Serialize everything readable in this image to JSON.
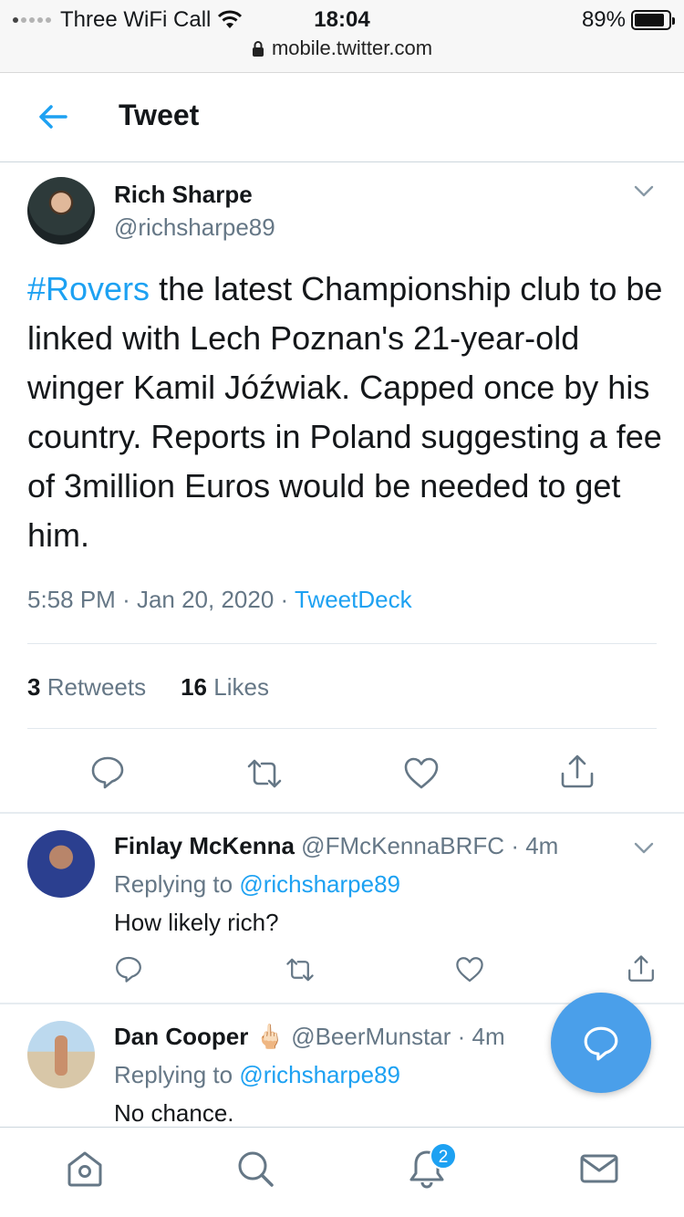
{
  "status_bar": {
    "carrier": "Three WiFi Call",
    "time": "18:04",
    "battery": "89%",
    "battery_level": 0.89,
    "url": "mobile.twitter.com"
  },
  "header": {
    "title": "Tweet",
    "back_icon": "arrow-left-icon"
  },
  "tweet": {
    "author_name": "Rich Sharpe",
    "author_handle": "@richsharpe89",
    "hashtag": "#Rovers",
    "text": " the latest Championship club to be linked with Lech Poznan's 21-year-old winger Kamil Jóźwiak. Capped once by his country. Reports in Poland suggesting a fee of 3million Euros would be needed to get him.",
    "time": "5:58 PM",
    "date": "Jan 20, 2020",
    "source": "TweetDeck",
    "retweets_count": "3",
    "retweets_label": "Retweets",
    "likes_count": "16",
    "likes_label": "Likes"
  },
  "replies": [
    {
      "name": "Finlay McKenna",
      "handle": "@FMcKennaBRFC",
      "age": "4m",
      "replying_prefix": "Replying to",
      "replying_to": "@richsharpe89",
      "text": "How likely rich?"
    },
    {
      "name": "Dan Cooper",
      "emoji": "🖕🏻",
      "handle": "@BeerMunstar",
      "age": "4m",
      "replying_prefix": "Replying to",
      "replying_to": "@richsharpe89",
      "text": "No chance."
    }
  ],
  "bottom_nav": {
    "notifications_badge": "2",
    "items": [
      "home-icon",
      "search-icon",
      "notifications-icon",
      "messages-icon"
    ]
  },
  "colors": {
    "accent": "#1da1f2",
    "muted": "#657786",
    "fab": "#4a9fea"
  }
}
